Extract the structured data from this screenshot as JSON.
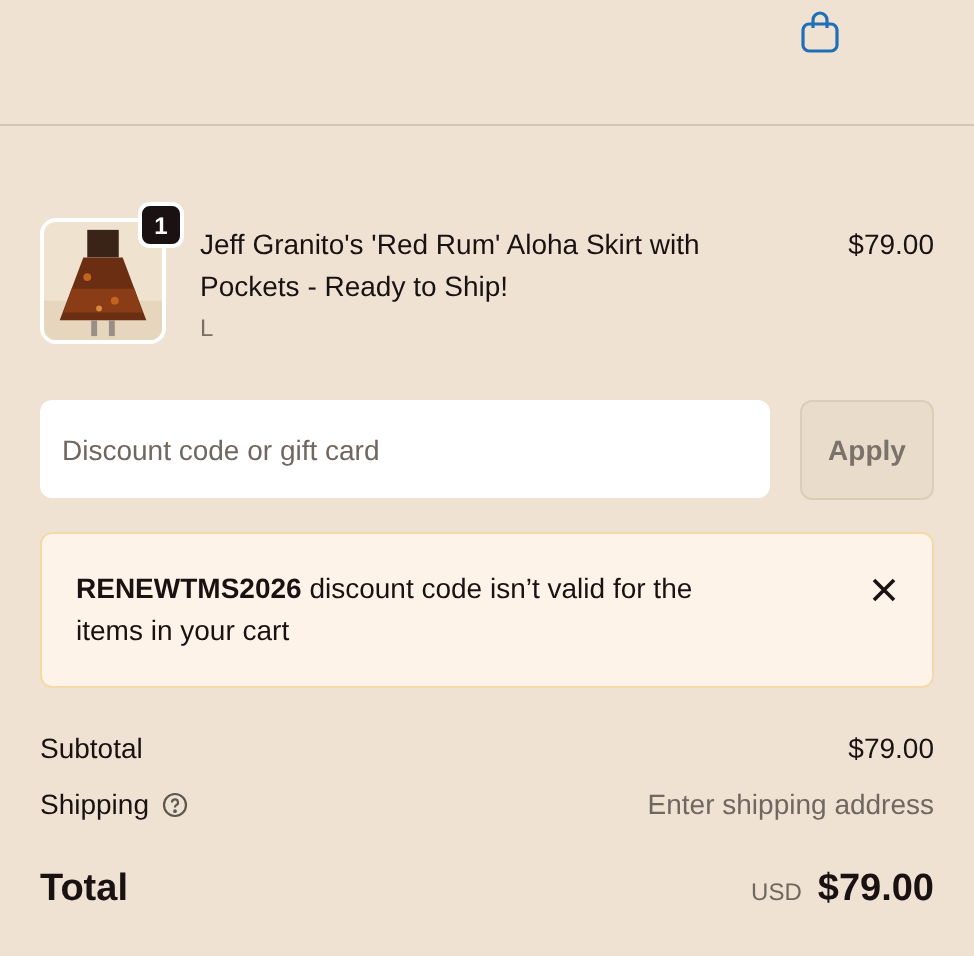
{
  "line_items": [
    {
      "quantity": "1",
      "title": "Jeff Granito's 'Red Rum' Aloha Skirt with Pockets - Ready to Ship!",
      "variant": "L",
      "price": "$79.00"
    }
  ],
  "discount": {
    "placeholder": "Discount code or gift card",
    "apply_button": "Apply",
    "disabled": true
  },
  "error_banner": {
    "message": "**RENEWTMS2026** discount code isn’t valid for the items in your cart"
  },
  "summary": {
    "rows": [
      {
        "kind": "plain",
        "label": "Subtotal",
        "value": "$79.00"
      },
      {
        "kind": "hint",
        "label": "Shipping",
        "value": "Enter shipping address"
      }
    ],
    "total": {
      "label": "Total",
      "currency": "USD",
      "value": "$79.00"
    }
  }
}
